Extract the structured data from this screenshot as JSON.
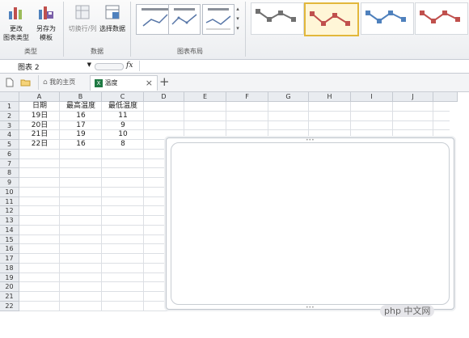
{
  "ribbon": {
    "change_type_label": "更改\n图表类型",
    "save_template_label": "另存为\n模板",
    "switch_rowcol_label": "切换行/列",
    "select_data_label": "选择数据",
    "group_type": "类型",
    "group_data": "数据",
    "group_layout": "图表布局",
    "style_colors": [
      "#707070",
      "#c0504d",
      "#4f81bd",
      "#c0504d"
    ]
  },
  "formula_bar": {
    "name_box": "图表 2",
    "fx": "fx"
  },
  "tabs": {
    "home_label": "我的主页",
    "sheet_label": "温度",
    "close": "×",
    "add": "+"
  },
  "sheet": {
    "columns": [
      "A",
      "B",
      "C",
      "D",
      "E",
      "F",
      "G",
      "H",
      "I",
      "J"
    ],
    "rows": [
      "1",
      "2",
      "3",
      "4",
      "5",
      "6",
      "7",
      "8",
      "9",
      "10",
      "11",
      "12",
      "13",
      "14",
      "15",
      "16",
      "17",
      "18",
      "19",
      "20",
      "21",
      "22"
    ],
    "header_row": [
      "日期",
      "最高温度",
      "最低温度"
    ],
    "data": [
      [
        "19日",
        "16",
        "11"
      ],
      [
        "20日",
        "17",
        "9"
      ],
      [
        "21日",
        "19",
        "10"
      ],
      [
        "22日",
        "16",
        "8"
      ]
    ]
  },
  "watermark": "php 中文网"
}
